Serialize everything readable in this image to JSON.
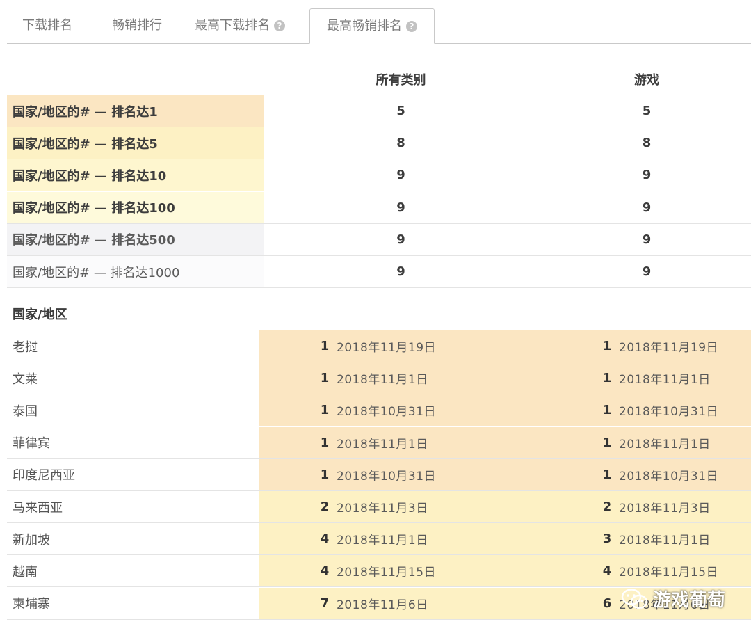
{
  "tabs": [
    {
      "label": "下载排名",
      "help": false,
      "active": false
    },
    {
      "label": "畅销排行",
      "help": false,
      "active": false
    },
    {
      "label": "最高下载排名",
      "help": true,
      "active": false
    },
    {
      "label": "最高畅销排名",
      "help": true,
      "active": true
    }
  ],
  "columns": [
    "所有类别",
    "游戏"
  ],
  "summary_rows": [
    {
      "label": "国家/地区的# — 排名达1",
      "all": "5",
      "games": "5",
      "color": "#fbe6c2"
    },
    {
      "label": "国家/地区的# — 排名达5",
      "all": "8",
      "games": "8",
      "color": "#fdf1c4"
    },
    {
      "label": "国家/地区的# — 排名达10",
      "all": "9",
      "games": "9",
      "color": "#fef6cf"
    },
    {
      "label": "国家/地区的# — 排名达100",
      "all": "9",
      "games": "9",
      "color": "#fefadb"
    },
    {
      "label": "国家/地区的# — 排名达500",
      "all": "9",
      "games": "9",
      "color": "#f3f3f5"
    },
    {
      "label": "国家/地区的# — 排名达1000",
      "all": "9",
      "games": "9",
      "color": "#fbfbfc"
    }
  ],
  "section_header": "国家/地区",
  "country_rows": [
    {
      "country": "老挝",
      "all_rank": "1",
      "all_date": "2018年11月19日",
      "games_rank": "1",
      "games_date": "2018年11月19日",
      "color": "#fbe6c2"
    },
    {
      "country": "文莱",
      "all_rank": "1",
      "all_date": "2018年11月1日",
      "games_rank": "1",
      "games_date": "2018年11月1日",
      "color": "#fbe6c2"
    },
    {
      "country": "泰国",
      "all_rank": "1",
      "all_date": "2018年10月31日",
      "games_rank": "1",
      "games_date": "2018年10月31日",
      "color": "#fbe6c2"
    },
    {
      "country": "菲律宾",
      "all_rank": "1",
      "all_date": "2018年11月1日",
      "games_rank": "1",
      "games_date": "2018年11月1日",
      "color": "#fbe6c2"
    },
    {
      "country": "印度尼西亚",
      "all_rank": "1",
      "all_date": "2018年10月31日",
      "games_rank": "1",
      "games_date": "2018年10月31日",
      "color": "#fbe6c2"
    },
    {
      "country": "马来西亚",
      "all_rank": "2",
      "all_date": "2018年11月3日",
      "games_rank": "2",
      "games_date": "2018年11月3日",
      "color": "#fdf1c4"
    },
    {
      "country": "新加坡",
      "all_rank": "4",
      "all_date": "2018年11月1日",
      "games_rank": "3",
      "games_date": "2018年11月1日",
      "color": "#fdf1c4"
    },
    {
      "country": "越南",
      "all_rank": "4",
      "all_date": "2018年11月15日",
      "games_rank": "4",
      "games_date": "2018年11月15日",
      "color": "#fdf1c4"
    },
    {
      "country": "柬埔寨",
      "all_rank": "7",
      "all_date": "2018年11月6日",
      "games_rank": "6",
      "games_date": "2018年11月6日",
      "color": "#fdf1c4"
    }
  ],
  "watermark": "游戏葡萄"
}
